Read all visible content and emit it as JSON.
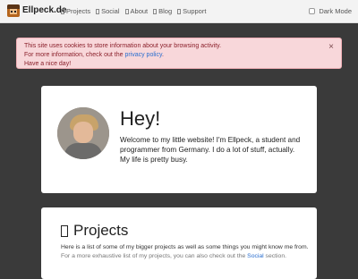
{
  "navbar": {
    "brand": "Ellpeck.de",
    "links": [
      {
        "label": "Projects",
        "icon": "projects-icon"
      },
      {
        "label": "Social",
        "icon": "social-icon"
      },
      {
        "label": "About",
        "icon": "about-icon"
      },
      {
        "label": "Blog",
        "icon": "blog-icon"
      },
      {
        "label": "Support",
        "icon": "support-icon"
      }
    ],
    "dark_mode_label": "Dark Mode"
  },
  "cookie_alert": {
    "line1": "This site uses cookies to store information about your browsing activity.",
    "line2_prefix": "For more information, check out the ",
    "line2_link": "privacy policy",
    "line2_suffix": ".",
    "line3": "Have a nice day!",
    "close_symbol": "×"
  },
  "intro": {
    "greeting": "Hey!",
    "text": "Welcome to my little website! I'm Ellpeck, a student and programmer from Germany. I do a lot of stuff, actually. My life is pretty busy."
  },
  "projects": {
    "title": "Projects",
    "line1": "Here is a list of some of my bigger projects as well as some things you might know me from.",
    "line2_prefix": "For a more exhaustive list of my projects, you can also check out the ",
    "line2_link": "Social",
    "line2_suffix": " section."
  },
  "colors": {
    "page_bg": "#3a3a3a",
    "alert_bg": "#f8d7da",
    "alert_text": "#8a1f2a",
    "link": "#2a6ecf"
  }
}
